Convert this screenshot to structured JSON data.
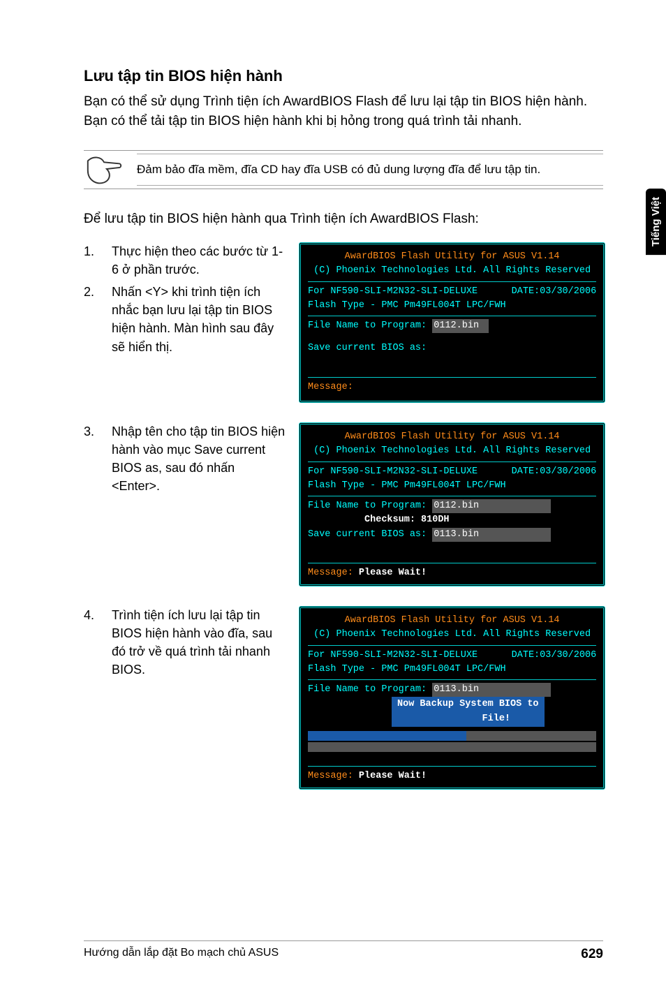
{
  "side_tab": "Tiếng Việt",
  "section_title": "Lưu tập tin BIOS hiện hành",
  "intro": "Bạn có thể sử dụng Trình tiện ích AwardBIOS Flash để lưu lại tập tin BIOS hiện hành. Bạn có thể tải tập tin BIOS hiện hành khi bị hỏng trong quá trình tải nhanh.",
  "note": "Đảm bảo đĩa mềm, đĩa CD hay đĩa USB có đủ dung lượng đĩa để lưu tập tin.",
  "lead": "Để lưu tập tin BIOS hiện hành qua Trình tiện ích AwardBIOS Flash:",
  "steps": {
    "s1": {
      "num": "1.",
      "text": "Thực hiện theo các bước từ 1-6 ở phần trước."
    },
    "s2": {
      "num": "2.",
      "text": "Nhấn <Y> khi trình tiện ích nhắc bạn lưu lại tập tin BIOS hiện hành. Màn hình sau đây sẽ hiển thị."
    },
    "s3": {
      "num": "3.",
      "text": "Nhập tên cho tập tin BIOS hiện hành vào mục Save current BIOS as, sau đó nhấn <Enter>."
    },
    "s4": {
      "num": "4.",
      "text": "Trình tiện ích lưu lại tập tin BIOS hiện hành vào đĩa, sau đó trở về quá trình tải nhanh BIOS."
    }
  },
  "term_common": {
    "title": "AwardBIOS Flash Utility for ASUS V1.14",
    "subtitle": "(C) Phoenix Technologies Ltd. All Rights Reserved",
    "board_line": "For NF590-SLI-M2N32-SLI-DELUXE      DATE:03/30/2006",
    "flash_line": "Flash Type - PMC Pm49FL004T LPC/FWH",
    "file_label": "File Name to Program: ",
    "save_label": "Save current BIOS as: ",
    "checksum_label": "          Checksum: ",
    "msg_label": " Message:"
  },
  "term1": {
    "file_value": "0112.bin",
    "save_value": ""
  },
  "term2": {
    "file_value": "0112.bin",
    "checksum_value": "810DH",
    "save_value": "0113.bin",
    "msg_text": " Please Wait!"
  },
  "term3": {
    "file_value": "0113.bin",
    "banner": "Now Backup System BIOS to\n          File!",
    "msg_text": " Please Wait!"
  },
  "footer": {
    "left": "Hướng dẫn lắp đặt Bo mạch chủ ASUS",
    "page": "629"
  }
}
